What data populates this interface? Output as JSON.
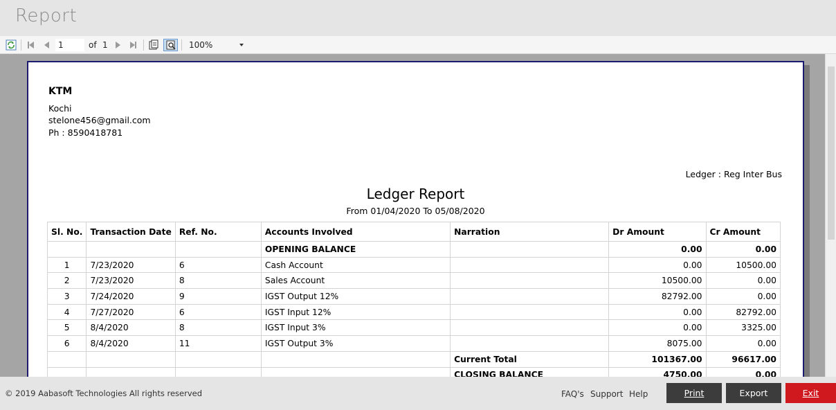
{
  "window": {
    "title": "Report"
  },
  "toolbar": {
    "current_page": "1",
    "of_label": "of",
    "total_pages": "1",
    "zoom": "100%",
    "icons": [
      "refresh-icon",
      "first-page-icon",
      "previous-page-icon",
      "next-page-icon",
      "last-page-icon",
      "print-layout-icon",
      "page-setup-icon"
    ]
  },
  "report": {
    "company": "KTM",
    "address_lines": [
      "Kochi",
      "stelone456@gmail.com",
      "Ph : 8590418781"
    ],
    "ledger_label": "Ledger : Reg Inter Bus",
    "title": "Ledger Report",
    "range": "From 01/04/2020  To 05/08/2020",
    "columns": [
      "Sl. No.",
      "Transaction Date",
      "Ref. No.",
      "Accounts Involved",
      "Narration",
      "Dr Amount",
      "Cr Amount"
    ],
    "opening": {
      "label": "OPENING BALANCE",
      "dr": "0.00",
      "cr": "0.00"
    },
    "rows": [
      {
        "sl": "1",
        "date": "7/23/2020",
        "ref": "6",
        "account": "Cash Account",
        "narration": "",
        "dr": "0.00",
        "cr": "10500.00"
      },
      {
        "sl": "2",
        "date": "7/23/2020",
        "ref": "8",
        "account": "Sales Account",
        "narration": "",
        "dr": "10500.00",
        "cr": "0.00"
      },
      {
        "sl": "3",
        "date": "7/24/2020",
        "ref": "9",
        "account": "IGST Output 12%",
        "narration": "",
        "dr": "82792.00",
        "cr": "0.00"
      },
      {
        "sl": "4",
        "date": "7/27/2020",
        "ref": "6",
        "account": "IGST Input 12%",
        "narration": "",
        "dr": "0.00",
        "cr": "82792.00"
      },
      {
        "sl": "5",
        "date": "8/4/2020",
        "ref": "8",
        "account": "IGST Input 3%",
        "narration": "",
        "dr": "0.00",
        "cr": "3325.00"
      },
      {
        "sl": "6",
        "date": "8/4/2020",
        "ref": "11",
        "account": "IGST Output 3%",
        "narration": "",
        "dr": "8075.00",
        "cr": "0.00"
      }
    ],
    "current_total": {
      "label": "Current Total",
      "dr": "101367.00",
      "cr": "96617.00"
    },
    "closing": {
      "label": "CLOSING BALANCE",
      "dr": "4750.00",
      "cr": "0.00"
    }
  },
  "footer": {
    "copyright": "© 2019 Aabasoft Technologies All rights reserved",
    "links": {
      "faq": "FAQ's",
      "support": "Support",
      "help": "Help"
    },
    "buttons": {
      "print": "Print",
      "export": "Export",
      "exit": "Exit"
    }
  },
  "colors": {
    "exit_button": "#d0191f",
    "dark_button": "#3c3c3c",
    "page_border": "#1a1a6e"
  }
}
